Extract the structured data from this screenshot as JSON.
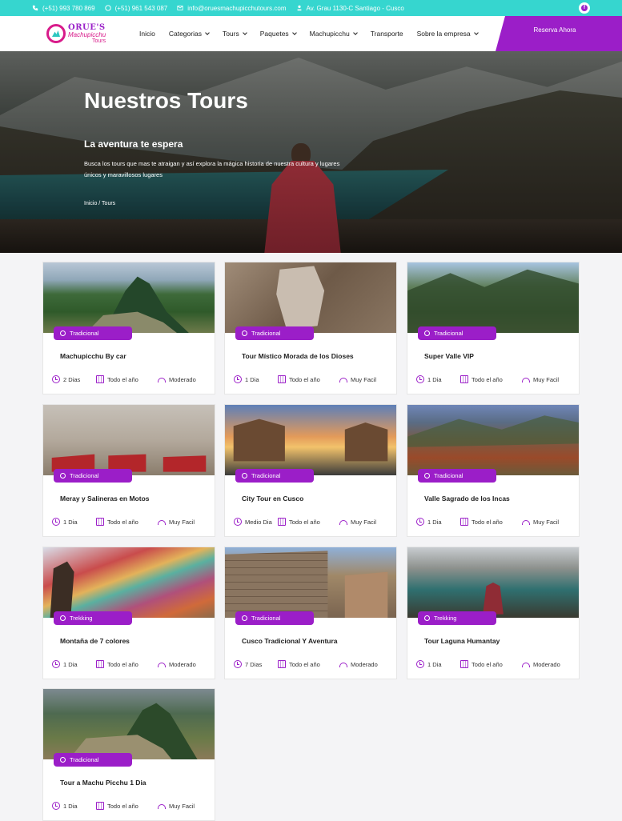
{
  "topbar": {
    "phone1": "(+51) 993 780 869",
    "phone2": "(+51) 961 543 087",
    "email": "info@oruesmachupicchutours.com",
    "address": "Av. Grau 1130-C Santiago - Cusco",
    "social": "f"
  },
  "logo": {
    "line1": "ORUE'S",
    "line2": "Machupicchu",
    "line3": "Tours"
  },
  "nav": {
    "items": [
      {
        "label": "Inicio",
        "dropdown": false
      },
      {
        "label": "Categorias",
        "dropdown": true
      },
      {
        "label": "Tours",
        "dropdown": true
      },
      {
        "label": "Paquetes",
        "dropdown": true
      },
      {
        "label": "Machupicchu",
        "dropdown": true
      },
      {
        "label": "Transporte",
        "dropdown": false
      },
      {
        "label": "Sobre la empresa",
        "dropdown": true
      }
    ],
    "cta": "Reserva Ahora"
  },
  "hero": {
    "title": "Nuestros Tours",
    "subtitle": "La aventura te espera",
    "description": "Busca los tours que mas te atraigan y así explora la mágica historia de nuestra cultura y lugares únicos y maravillosos lugares",
    "breadcrumb": "Inicio / Tours"
  },
  "tours": [
    {
      "title": "Machupicchu By car",
      "category": "Tradicional",
      "duration": "2 Dias",
      "season": "Todo el año",
      "difficulty": "Moderado"
    },
    {
      "title": "Tour Místico Morada de los Dioses",
      "category": "Tradicional",
      "duration": "1 Dia",
      "season": "Todo el año",
      "difficulty": "Muy Facil"
    },
    {
      "title": "Super Valle VIP",
      "category": "Tradicional",
      "duration": "1 Dia",
      "season": "Todo el año",
      "difficulty": "Muy Facil"
    },
    {
      "title": "Meray y Salineras en Motos",
      "category": "Tradicional",
      "duration": "1 Dia",
      "season": "Todo el año",
      "difficulty": "Muy Facil"
    },
    {
      "title": "City Tour en Cusco",
      "category": "Tradicional",
      "duration": "Medio Dia",
      "season": "Todo el año",
      "difficulty": "Muy Facil"
    },
    {
      "title": "Valle Sagrado de los Incas",
      "category": "Tradicional",
      "duration": "1 Dia",
      "season": "Todo el año",
      "difficulty": "Muy Facil"
    },
    {
      "title": "Montaña de 7 colores",
      "category": "Trekking",
      "duration": "1 Dia",
      "season": "Todo el año",
      "difficulty": "Moderado"
    },
    {
      "title": "Cusco Tradicional Y Aventura",
      "category": "Tradicional",
      "duration": "7 Dias",
      "season": "Todo el año",
      "difficulty": "Moderado"
    },
    {
      "title": "Tour Laguna Humantay",
      "category": "Trekking",
      "duration": "1 Dia",
      "season": "Todo el año",
      "difficulty": "Moderado"
    },
    {
      "title": "Tour a Machu Picchu 1 Dia",
      "category": "Tradicional",
      "duration": "1 Dia",
      "season": "Todo el año",
      "difficulty": "Muy Facil"
    }
  ],
  "colors": {
    "topbar": "#36d6cf",
    "accent": "#9b1ec8"
  }
}
